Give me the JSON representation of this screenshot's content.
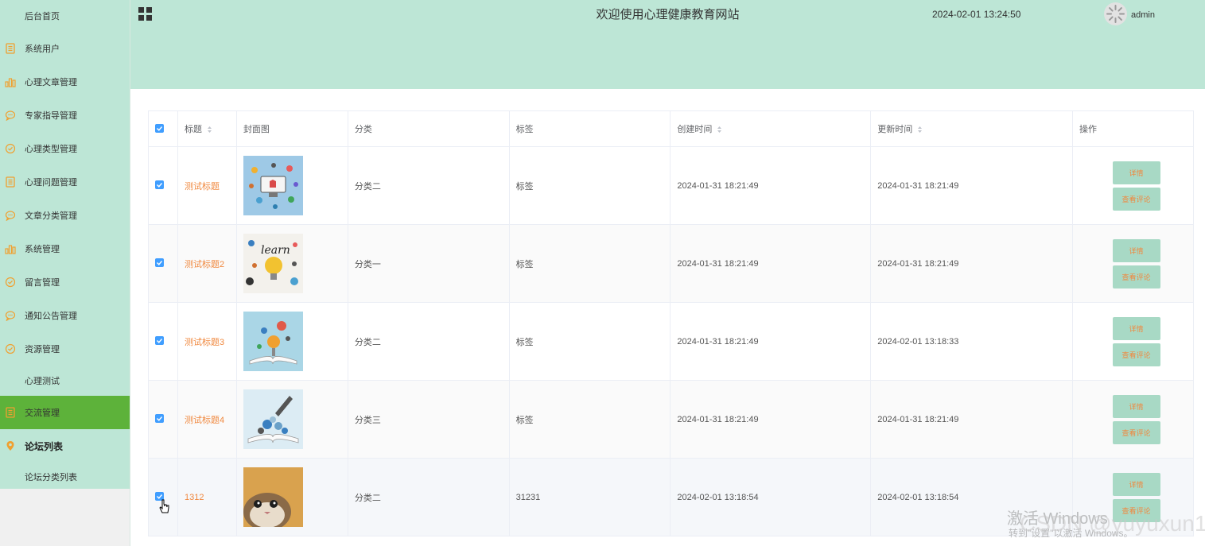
{
  "sidebar": {
    "items": [
      {
        "label": "后台首页",
        "icon": "none"
      },
      {
        "label": "系统用户",
        "icon": "document-icon"
      },
      {
        "label": "心理文章管理",
        "icon": "bar-chart-icon"
      },
      {
        "label": "专家指导管理",
        "icon": "chat-icon"
      },
      {
        "label": "心理类型管理",
        "icon": "check-circle-icon"
      },
      {
        "label": "心理问题管理",
        "icon": "document-icon"
      },
      {
        "label": "文章分类管理",
        "icon": "chat-icon"
      },
      {
        "label": "系统管理",
        "icon": "bar-chart-icon"
      },
      {
        "label": "留言管理",
        "icon": "check-circle-icon"
      },
      {
        "label": "通知公告管理",
        "icon": "chat-icon"
      },
      {
        "label": "资源管理",
        "icon": "check-circle-icon"
      },
      {
        "label": "心理测试",
        "icon": "none"
      },
      {
        "label": "交流管理",
        "icon": "document-icon"
      },
      {
        "label": "论坛列表",
        "icon": "location-pin-icon"
      },
      {
        "label": "论坛分类列表",
        "icon": "none"
      }
    ]
  },
  "header": {
    "title": "欢迎使用心理健康教育网站",
    "datetime": "2024-02-01 13:24:50",
    "username": "admin"
  },
  "table": {
    "columns": [
      "标题",
      "封面图",
      "分类",
      "标签",
      "创建时间",
      "更新时间",
      "操作"
    ],
    "rows": [
      {
        "title": "测试标题",
        "category": "分类二",
        "tag": "标签",
        "created": "2024-01-31 18:21:49",
        "updated": "2024-01-31 18:21:49",
        "checked": true
      },
      {
        "title": "测试标题2",
        "category": "分类一",
        "tag": "标签",
        "created": "2024-01-31 18:21:49",
        "updated": "2024-01-31 18:21:49",
        "checked": true
      },
      {
        "title": "测试标题3",
        "category": "分类二",
        "tag": "标签",
        "created": "2024-01-31 18:21:49",
        "updated": "2024-02-01 13:18:33",
        "checked": true
      },
      {
        "title": "测试标题4",
        "category": "分类三",
        "tag": "标签",
        "created": "2024-01-31 18:21:49",
        "updated": "2024-01-31 18:21:49",
        "checked": true
      },
      {
        "title": "1312",
        "category": "分类二",
        "tag": "31231",
        "created": "2024-02-01 13:18:54",
        "updated": "2024-02-01 13:18:54",
        "checked": true
      }
    ],
    "actions": {
      "detail": "详情",
      "comments": "查看评论"
    }
  },
  "watermark": {
    "activate": "激活 Windows",
    "activate_hint": "转到\"设置\"以激活 Windows。",
    "csdn": "CSDN @yuyuxun1"
  },
  "colors": {
    "header_bg": "#bde6d6",
    "active_menu": "#5db23a",
    "accent_orange": "#f0883e",
    "button_bg": "#a8d9c5",
    "checkbox": "#409eff"
  }
}
